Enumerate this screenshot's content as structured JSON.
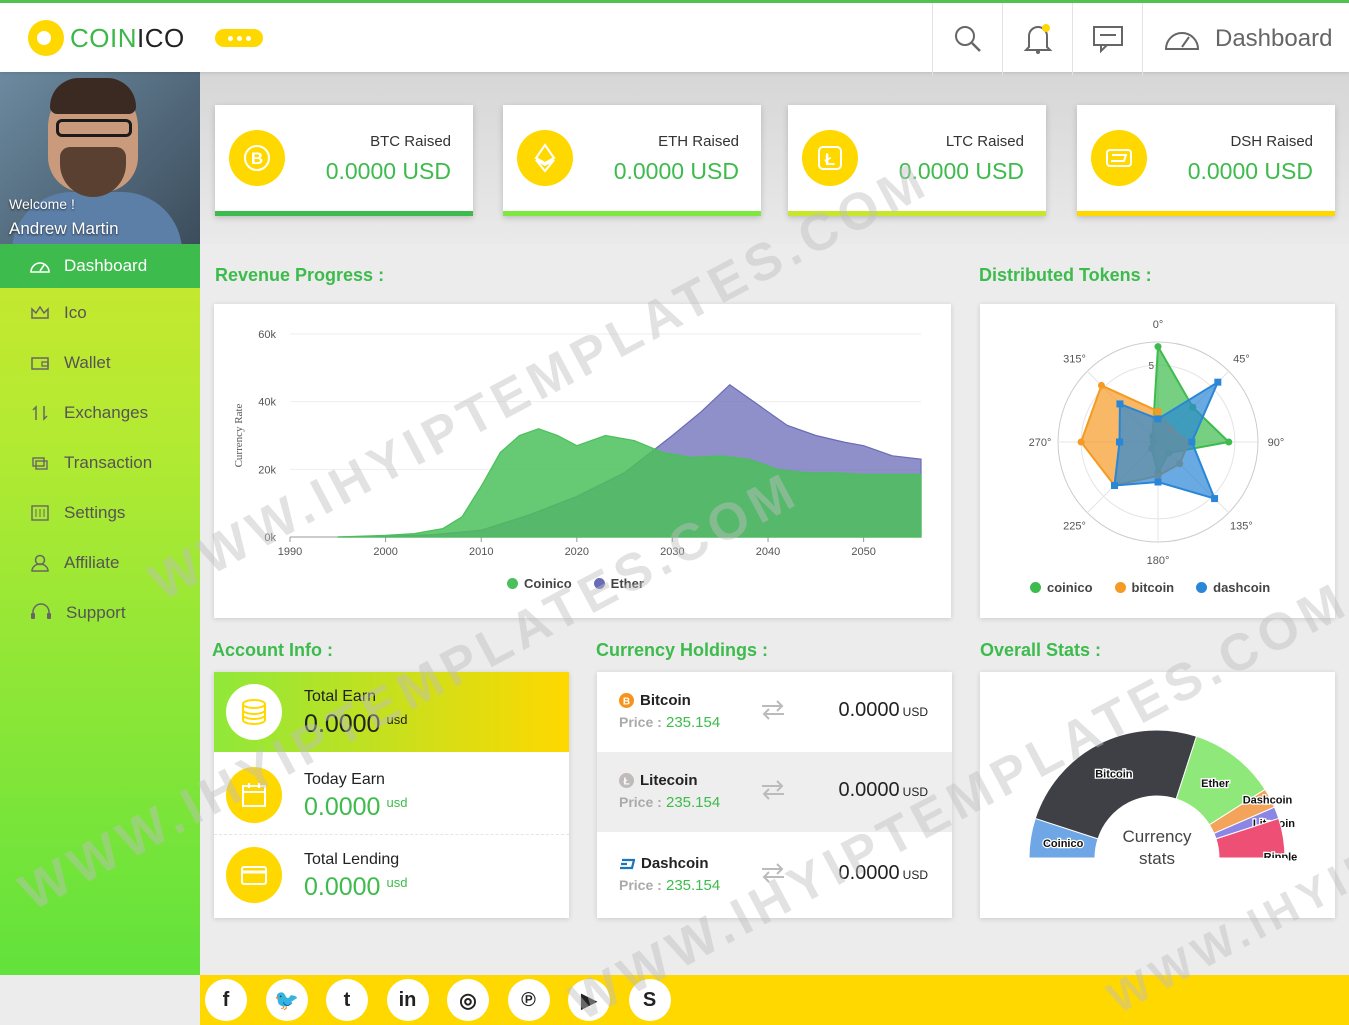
{
  "brand": {
    "logo_left": "COIN",
    "logo_right": "ICO"
  },
  "header": {
    "dashboard_label": "Dashboard"
  },
  "profile": {
    "welcome": "Welcome !",
    "name": "Andrew Martin"
  },
  "nav": [
    {
      "label": "Dashboard",
      "icon": "dashboard-icon"
    },
    {
      "label": "Ico",
      "icon": "crown-icon"
    },
    {
      "label": "Wallet",
      "icon": "wallet-icon"
    },
    {
      "label": "Exchanges",
      "icon": "exchange-icon"
    },
    {
      "label": "Transaction",
      "icon": "transaction-icon"
    },
    {
      "label": "Settings",
      "icon": "settings-icon"
    },
    {
      "label": "Affiliate",
      "icon": "user-icon"
    },
    {
      "label": "Support",
      "icon": "headset-icon"
    }
  ],
  "stats": [
    {
      "label": "BTC Raised",
      "value": "0.0000 USD",
      "icon": "bitcoin-icon",
      "bar_color": "#3dbb4c"
    },
    {
      "label": "ETH Raised",
      "value": "0.0000 USD",
      "icon": "ethereum-icon",
      "bar_color": "#7ee83e"
    },
    {
      "label": "LTC Raised",
      "value": "0.0000 USD",
      "icon": "litecoin-icon",
      "bar_color": "#c8e62a"
    },
    {
      "label": "DSH Raised",
      "value": "0.0000 USD",
      "icon": "dash-icon",
      "bar_color": "#ffd800"
    }
  ],
  "sections": {
    "revenue": "Revenue Progress :",
    "tokens": "Distributed Tokens :",
    "account": "Account Info :",
    "holdings": "Currency Holdings :",
    "overall": "Overall Stats :"
  },
  "chart_data": [
    {
      "type": "area",
      "title": "Revenue Progress :",
      "xlabel": "",
      "ylabel": "Currency Rate",
      "x_ticks": [
        "1990",
        "2000",
        "2010",
        "2020",
        "2030",
        "2040",
        "2050"
      ],
      "y_ticks": [
        "0k",
        "20k",
        "40k",
        "60k"
      ],
      "ylim": [
        0,
        60000
      ],
      "xlim": [
        1990,
        2056
      ],
      "series": [
        {
          "name": "Coinico",
          "color": "#4bbf5a",
          "x": [
            1995,
            2000,
            2003,
            2006,
            2008,
            2010,
            2012,
            2014,
            2016,
            2018,
            2020,
            2023,
            2026,
            2029,
            2032,
            2035,
            2038,
            2041,
            2044,
            2047,
            2050,
            2053,
            2056
          ],
          "values": [
            0,
            500,
            1000,
            2500,
            6000,
            15000,
            25000,
            30000,
            32000,
            30000,
            27000,
            30000,
            28500,
            25000,
            23500,
            24000,
            23000,
            20000,
            19000,
            19000,
            18500,
            18500,
            18500
          ]
        },
        {
          "name": "Ether",
          "color": "#6a6bb8",
          "x": [
            1995,
            2000,
            2005,
            2010,
            2015,
            2020,
            2025,
            2030,
            2033,
            2036,
            2039,
            2042,
            2045,
            2048,
            2050,
            2053,
            2056
          ],
          "values": [
            0,
            200,
            700,
            2000,
            6500,
            12000,
            19000,
            30000,
            37000,
            45000,
            39000,
            33000,
            30000,
            28000,
            27000,
            24000,
            23000
          ]
        }
      ]
    },
    {
      "type": "radar",
      "title": "Distributed Tokens :",
      "angle_labels": [
        "0°",
        "45°",
        "90°",
        "135°",
        "180°",
        "225°",
        "270°",
        "315°"
      ],
      "radial_tick": "5",
      "series": [
        {
          "name": "coinico",
          "color": "#3dbb4c",
          "values": [
            6.2,
            3.2,
            4.6,
            1.0,
            2.0,
            0.6,
            0.3,
            0.5
          ]
        },
        {
          "name": "bitcoin",
          "color": "#f59a23",
          "values": [
            2.0,
            1.2,
            2.0,
            2.0,
            2.2,
            4.0,
            5.0,
            5.2
          ]
        },
        {
          "name": "dashcoin",
          "color": "#2a86d6",
          "values": [
            1.5,
            5.5,
            2.2,
            5.2,
            2.6,
            4.0,
            2.5,
            3.5
          ]
        }
      ]
    },
    {
      "type": "pie",
      "title": "Overall Stats :",
      "center_label": "Currency stats",
      "categories": [
        "Coinico",
        "Bitcoin",
        "Ether",
        "Dashcoin",
        "Litecoin",
        "Ripple"
      ],
      "values": [
        10,
        50,
        22,
        5,
        3,
        10
      ],
      "colors": [
        "#6ea6e6",
        "#3e4046",
        "#8ee87a",
        "#f4a35a",
        "#8b86e6",
        "#ee4f74"
      ]
    }
  ],
  "legends": {
    "revenue": [
      {
        "name": "Coinico",
        "color": "#4bbf5a"
      },
      {
        "name": "Ether",
        "color": "#6a6bb8"
      }
    ],
    "tokens": [
      {
        "name": "coinico",
        "color": "#3dbb4c"
      },
      {
        "name": "bitcoin",
        "color": "#f59a23"
      },
      {
        "name": "dashcoin",
        "color": "#2a86d6"
      }
    ]
  },
  "account": [
    {
      "label": "Total Earn",
      "value": "0.0000",
      "unit": "usd",
      "icon": "coins-icon"
    },
    {
      "label": "Today Earn",
      "value": "0.0000",
      "unit": "usd",
      "icon": "calendar-icon"
    },
    {
      "label": "Total Lending",
      "value": "0.0000",
      "unit": "usd",
      "icon": "card-icon"
    }
  ],
  "holdings": [
    {
      "name": "Bitcoin",
      "price_label": "Price :",
      "price": "235.154",
      "value": "0.0000",
      "unit": "USD",
      "icon": "bitcoin-icon"
    },
    {
      "name": "Litecoin",
      "price_label": "Price :",
      "price": "235.154",
      "value": "0.0000",
      "unit": "USD",
      "icon": "litecoin-icon"
    },
    {
      "name": "Dashcoin",
      "price_label": "Price :",
      "price": "235.154",
      "value": "0.0000",
      "unit": "USD",
      "icon": "dash-icon"
    }
  ],
  "social": [
    {
      "glyph": "f",
      "icon": "facebook-icon"
    },
    {
      "glyph": "🐦",
      "icon": "twitter-icon"
    },
    {
      "glyph": "t",
      "icon": "tumblr-icon"
    },
    {
      "glyph": "in",
      "icon": "linkedin-icon"
    },
    {
      "glyph": "◎",
      "icon": "instagram-icon"
    },
    {
      "glyph": "℗",
      "icon": "pinterest-icon"
    },
    {
      "glyph": "▶",
      "icon": "youtube-icon"
    },
    {
      "glyph": "S",
      "icon": "skype-icon"
    }
  ],
  "watermark": "WWW.IHYIPTEMPLATES.COM"
}
